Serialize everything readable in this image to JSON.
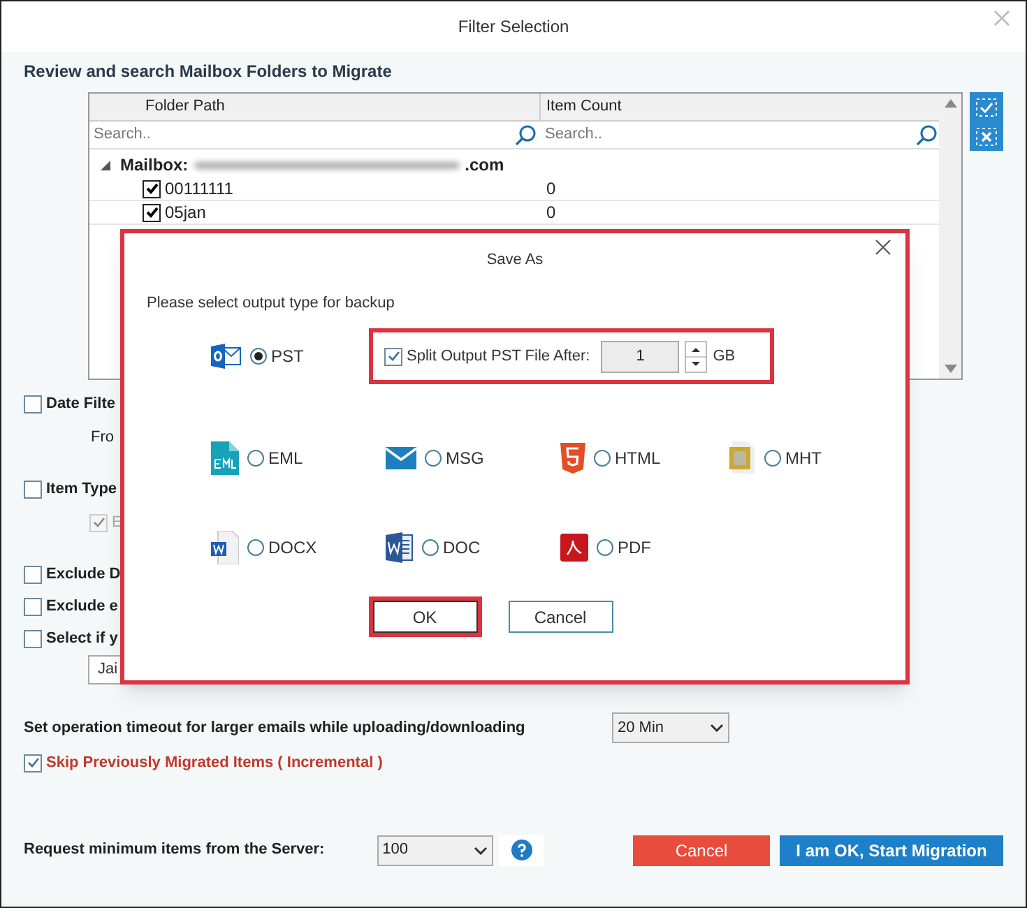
{
  "window": {
    "title": "Filter Selection"
  },
  "section_title": "Review and search Mailbox Folders to Migrate",
  "folder_table": {
    "columns": [
      "Folder Path",
      "Item Count"
    ],
    "search_placeholders": [
      "Search..",
      "Search.."
    ],
    "mailbox": {
      "label": "Mailbox:",
      "suffix": ".com",
      "expanded": true
    },
    "rows": [
      {
        "name": "00111111",
        "count": "0",
        "checked": true
      },
      {
        "name": "05jan",
        "count": "0",
        "checked": true
      }
    ]
  },
  "filters": [
    {
      "kind": "checkbox",
      "label": "Date Filte",
      "checked": false
    },
    {
      "kind": "sublabel",
      "label": "Fro"
    },
    {
      "kind": "checkbox",
      "label": "Item Type",
      "checked": false
    },
    {
      "kind": "subcheck",
      "label": "E",
      "checked": true,
      "disabled": true
    },
    {
      "kind": "checkbox",
      "label": "Exclude D",
      "checked": false
    },
    {
      "kind": "checkbox",
      "label": "Exclude e",
      "checked": false
    },
    {
      "kind": "checkbox",
      "label": "Select if y",
      "checked": false
    },
    {
      "kind": "field",
      "value": "Jai"
    }
  ],
  "timeout": {
    "label": "Set operation timeout for larger emails while uploading/downloading",
    "value": "20 Min"
  },
  "skip_migrated": {
    "label": "Skip Previously Migrated Items ( Incremental )",
    "checked": true
  },
  "min_items": {
    "label": "Request minimum items from the Server:",
    "value": "100"
  },
  "buttons": [
    {
      "label": "Cancel",
      "kind": "cancel"
    },
    {
      "label": "I am OK, Start Migration",
      "kind": "primary"
    }
  ],
  "save_as": {
    "title": "Save As",
    "prompt": "Please select output type for backup",
    "formats": [
      {
        "label": "PST",
        "selected": true
      },
      {
        "label": "EML",
        "selected": false
      },
      {
        "label": "MSG",
        "selected": false
      },
      {
        "label": "HTML",
        "selected": false
      },
      {
        "label": "MHT",
        "selected": false
      },
      {
        "label": "DOCX",
        "selected": false
      },
      {
        "label": "DOC",
        "selected": false
      },
      {
        "label": "PDF",
        "selected": false
      }
    ],
    "split": {
      "label": "Split Output PST File After:",
      "checked": true,
      "value": "1",
      "unit": "GB"
    },
    "buttons": [
      {
        "label": "OK",
        "highlighted": true
      },
      {
        "label": "Cancel",
        "highlighted": false
      }
    ]
  }
}
